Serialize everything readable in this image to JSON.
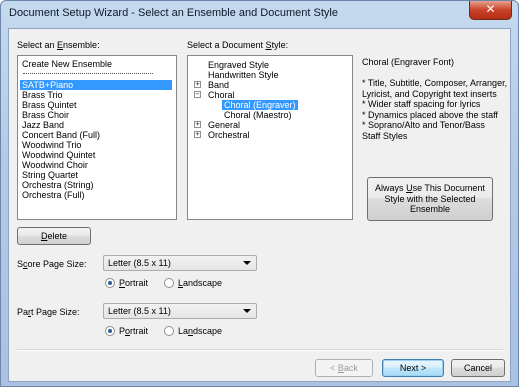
{
  "window": {
    "title": "Document Setup Wizard - Select an Ensemble and Document Style",
    "close_glyph": "✕"
  },
  "ensemble": {
    "label_pre": "Select an ",
    "label_u": "E",
    "label_post": "nsemble:",
    "items": [
      "Create New Ensemble",
      "SATB+Piano",
      "Brass Trio",
      "Brass Quintet",
      "Brass Choir",
      "Jazz Band",
      "Concert Band (Full)",
      "Woodwind Trio",
      "Woodwind Quintet",
      "Woodwind Choir",
      "String Quartet",
      "Orchestra (String)",
      "Orchestra (Full)"
    ],
    "selected": "SATB+Piano"
  },
  "style": {
    "label_pre": "Select a Document ",
    "label_u": "S",
    "label_post": "tyle:",
    "tree": [
      {
        "label": "Engraved Style",
        "expander": ""
      },
      {
        "label": "Handwritten Style",
        "expander": ""
      },
      {
        "label": "Band",
        "expander": "+"
      },
      {
        "label": "Choral",
        "expander": "−"
      },
      {
        "label": "Choral (Engraver)",
        "expander": "",
        "child": true,
        "selected": true
      },
      {
        "label": "Choral (Maestro)",
        "expander": "",
        "child": true
      },
      {
        "label": "General",
        "expander": "+"
      },
      {
        "label": "Orchestral",
        "expander": "+"
      }
    ]
  },
  "description": {
    "title": "Choral (Engraver Font)",
    "lines": [
      "* Title, Subtitle, Composer, Arranger,",
      "Lyricist, and Copyright text inserts",
      "* Wider staff spacing for lyrics",
      "* Dynamics placed above the staff",
      "* Soprano/Alto and Tenor/Bass",
      "Staff Styles"
    ]
  },
  "always_use_button": {
    "line1_pre": "Always ",
    "line1_u": "U",
    "line1_post": "se This Document",
    "line2": "Style with the Selected",
    "line3": "Ensemble"
  },
  "delete_button": {
    "u": "D",
    "rest": "elete"
  },
  "score_page": {
    "label_pre": "S",
    "label_u": "c",
    "label_post": "ore Page Size:",
    "value": "Letter (8.5 x 11)",
    "portrait_u": "P",
    "portrait_rest": "ortrait",
    "landscape_u": "L",
    "landscape_rest": "andscape",
    "orientation": "portrait"
  },
  "part_page": {
    "label_pre": "Pa",
    "label_u": "r",
    "label_post": "t Page Size:",
    "value": "Letter (8.5 x 11)",
    "portrait_pre": "P",
    "portrait_u": "o",
    "portrait_rest": "rtrait",
    "landscape_pre": "La",
    "landscape_u": "n",
    "landscape_rest": "dscape",
    "orientation": "portrait"
  },
  "footer": {
    "back_pre": "< ",
    "back_u": "B",
    "back_rest": "ack",
    "next": "Next >",
    "cancel": "Cancel"
  }
}
